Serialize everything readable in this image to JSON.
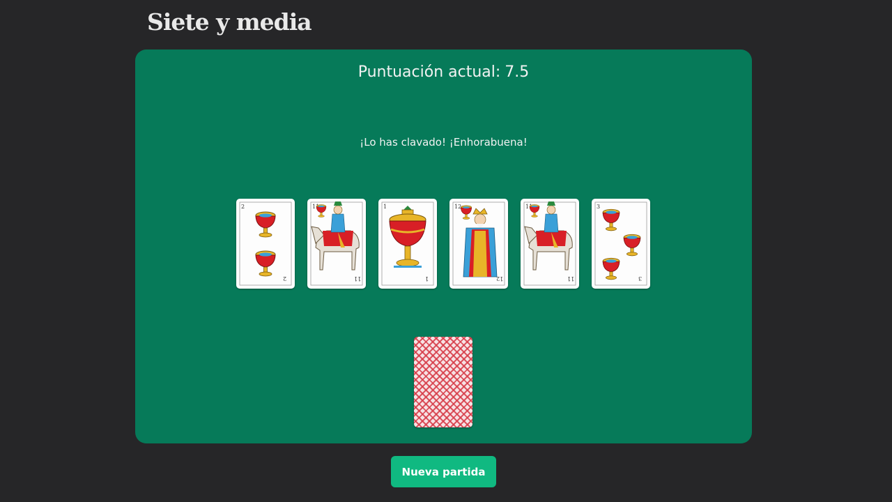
{
  "app": {
    "title": "Siete y media"
  },
  "score": {
    "label": "Puntuación actual:",
    "value": "7.5"
  },
  "message": "¡Lo has clavado! ¡Enhorabuena!",
  "hand": [
    {
      "number": "2",
      "suit": "copas",
      "figure": "two-cups"
    },
    {
      "number": "11",
      "suit": "copas",
      "figure": "caballo-de-copas"
    },
    {
      "number": "1",
      "suit": "copas",
      "figure": "as-de-copas"
    },
    {
      "number": "12",
      "suit": "copas",
      "figure": "rey-de-copas"
    },
    {
      "number": "11",
      "suit": "copas",
      "figure": "caballo-de-copas"
    },
    {
      "number": "3",
      "suit": "copas",
      "figure": "three-cups"
    }
  ],
  "deck": {
    "icon": "card-back-icon"
  },
  "actions": {
    "new_game_label": "Nueva partida"
  },
  "colors": {
    "background": "#262628",
    "table": "#067a59",
    "button": "#10b981",
    "card_back": "#d63a46"
  }
}
